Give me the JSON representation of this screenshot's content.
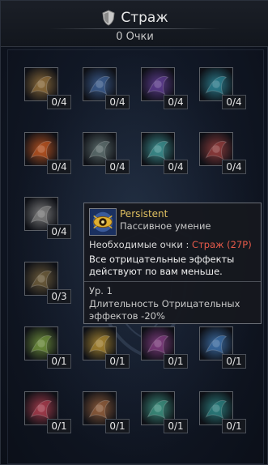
{
  "header": {
    "title": "Страж",
    "points": "0 Очки"
  },
  "skills": [
    {
      "count": "0/4",
      "icon": "bronze-wing-icon",
      "color": "#8a6a3a"
    },
    {
      "count": "0/4",
      "icon": "blue-claw-icon",
      "color": "#3a5a8a"
    },
    {
      "count": "0/4",
      "icon": "purple-burst-icon",
      "color": "#5a3a8a"
    },
    {
      "count": "0/4",
      "icon": "teal-mask-icon",
      "color": "#2a7a8a"
    },
    {
      "count": "0/4",
      "icon": "fire-orb-icon",
      "color": "#b05020"
    },
    {
      "count": "0/4",
      "icon": "steel-wheel-icon",
      "color": "#5a6a6a"
    },
    {
      "count": "0/4",
      "icon": "teal-cross-icon",
      "color": "#3a8a8a"
    },
    {
      "count": "0/4",
      "icon": "red-star-icon",
      "color": "#8a3a3a"
    },
    {
      "count": "0/4",
      "icon": "silver-arrow-icon",
      "color": "#7a7a7a"
    },
    {
      "count": "0/3",
      "icon": "bronze-cross-icon",
      "color": "#6a5a3a"
    },
    {
      "count": "0/1",
      "icon": "green-swirl-icon",
      "color": "#6a8a3a"
    },
    {
      "count": "0/1",
      "icon": "golden-eye-icon",
      "color": "#a08030"
    },
    {
      "count": "0/1",
      "icon": "violet-claw-icon",
      "color": "#7a3a7a"
    },
    {
      "count": "0/1",
      "icon": "blue-blade-icon",
      "color": "#3a6aa0"
    },
    {
      "count": "0/1",
      "icon": "crimson-spiral-icon",
      "color": "#a03a4a"
    },
    {
      "count": "0/1",
      "icon": "bronze-rune-icon",
      "color": "#8a5a3a"
    },
    {
      "count": "0/1",
      "icon": "teal-figure-icon",
      "color": "#3a8a7a"
    },
    {
      "count": "0/1",
      "icon": "teal-gear-icon",
      "color": "#2a7a7a"
    }
  ],
  "tooltip": {
    "name": "Persistent",
    "type": "Пассивное умение",
    "req_label": "Необходимые очки :",
    "req_value": "Страж (27P)",
    "description": "Все отрицательные эффекты действуют по вам меньше.",
    "level": "Ур. 1",
    "effect": "Длительность Отрицательных эффектов -20%",
    "name_color": "#e0c060",
    "req_color": "#e85a4a"
  }
}
